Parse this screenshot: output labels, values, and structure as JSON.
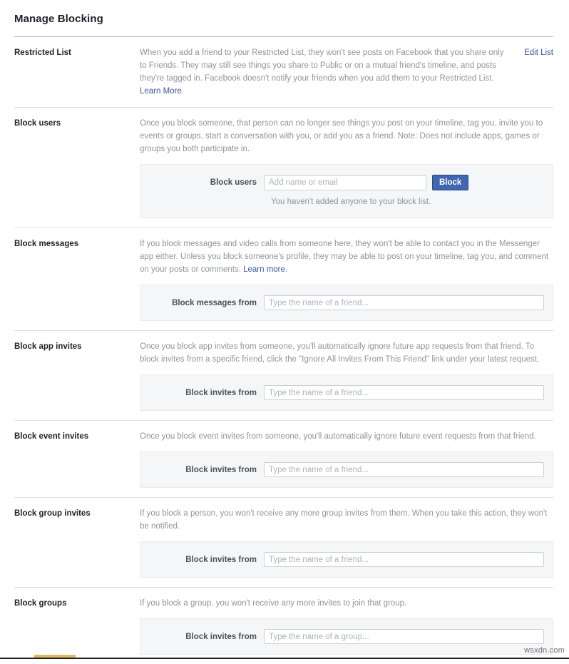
{
  "header": {
    "title": "Manage Blocking"
  },
  "sections": [
    {
      "label": "Restricted List",
      "desc_before_link": "When you add a friend to your Restricted List, they won't see posts on Facebook that you share only to Friends. They may still see things you share to Public or on a mutual friend's timeline, and posts they're tagged in. Facebook doesn't notify your friends when you add them to your Restricted List. ",
      "link_text": "Learn More",
      "desc_after_link": ".",
      "action_link": "Edit List",
      "form": null
    },
    {
      "label": "Block users",
      "desc_before_link": "Once you block someone, that person can no longer see things you post on your timeline, tag you, invite you to events or groups, start a conversation with you, or add you as a friend. Note: Does not include apps, games or groups you both participate in.",
      "link_text": "",
      "desc_after_link": "",
      "action_link": "",
      "form": {
        "label": "Block users",
        "placeholder": "Add name or email",
        "value": "",
        "field_width": "narrow",
        "button_label": "Block",
        "note": "You haven't added anyone to your block list."
      }
    },
    {
      "label": "Block messages",
      "desc_before_link": "If you block messages and video calls from someone here, they won't be able to contact you in the Messenger app either. Unless you block someone's profile, they may be able to post on your timeline, tag you, and comment on your posts or comments. ",
      "link_text": "Learn more",
      "desc_after_link": ".",
      "action_link": "",
      "form": {
        "label": "Block messages from",
        "placeholder": "Type the name of a friend...",
        "value": "",
        "field_width": "wide",
        "button_label": "",
        "note": ""
      }
    },
    {
      "label": "Block app invites",
      "desc_before_link": "Once you block app invites from someone, you'll automatically ignore future app requests from that friend. To block invites from a specific friend, click the \"Ignore All Invites From This Friend\" link under your latest request.",
      "link_text": "",
      "desc_after_link": "",
      "action_link": "",
      "form": {
        "label": "Block invites from",
        "placeholder": "Type the name of a friend...",
        "value": "",
        "field_width": "wide",
        "button_label": "",
        "note": ""
      }
    },
    {
      "label": "Block event invites",
      "desc_before_link": "Once you block event invites from someone, you'll automatically ignore future event requests from that friend.",
      "link_text": "",
      "desc_after_link": "",
      "action_link": "",
      "form": {
        "label": "Block invites from",
        "placeholder": "Type the name of a friend...",
        "value": "",
        "field_width": "wide",
        "button_label": "",
        "note": ""
      }
    },
    {
      "label": "Block group invites",
      "desc_before_link": "If you block a person, you won't receive any more group invites from them. When you take this action, they won't be notified.",
      "link_text": "",
      "desc_after_link": "",
      "action_link": "",
      "form": {
        "label": "Block invites from",
        "placeholder": "Type the name of a friend...",
        "value": "",
        "field_width": "wide",
        "button_label": "",
        "note": ""
      }
    },
    {
      "label": "Block groups",
      "desc_before_link": "If you block a group, you won't receive any more invites to join that group.",
      "link_text": "",
      "desc_after_link": "",
      "action_link": "",
      "form": {
        "label": "Block invites from",
        "placeholder": "Type the name of a group...",
        "value": "",
        "field_width": "wide",
        "button_label": "",
        "note": ""
      }
    }
  ],
  "watermark": "wsxdn.com",
  "colors": {
    "accent_blue": "#4267b2",
    "link_blue": "#365899",
    "panel_gray": "#f5f6f7",
    "muted_text": "#90949c",
    "bottom_tab": "#e3b765"
  }
}
